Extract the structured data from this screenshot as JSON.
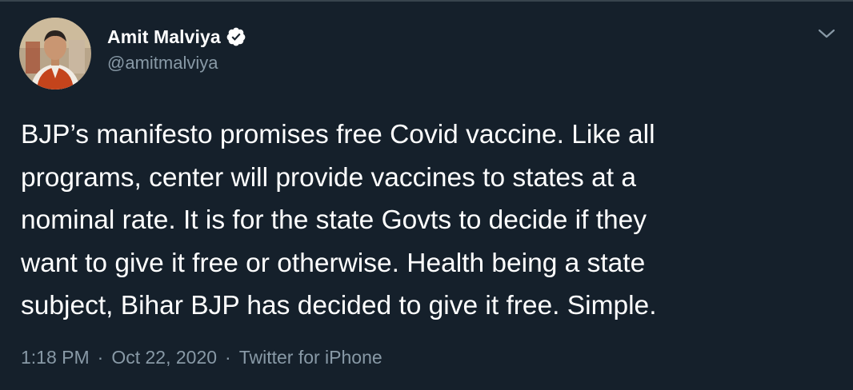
{
  "author": {
    "display_name": "Amit Malviya",
    "handle": "@amitmalviya",
    "verified": true
  },
  "tweet": {
    "lines": [
      "BJP’s manifesto promises free Covid vaccine. Like all",
      "programs, center will provide vaccines to states at a",
      "nominal rate. It is for the state Govts to decide if they",
      "want to give it free or otherwise. Health being a state",
      "subject, Bihar BJP has decided to give it free. Simple."
    ],
    "time": "1:18 PM",
    "separator": "·",
    "date": "Oct 22, 2020",
    "source": "Twitter for iPhone"
  },
  "icons": {
    "verified": "verified-badge-icon",
    "more": "chevron-down-icon"
  },
  "colors": {
    "background": "#15202b",
    "primary_text": "#ffffff",
    "secondary_text": "#8899a6"
  }
}
